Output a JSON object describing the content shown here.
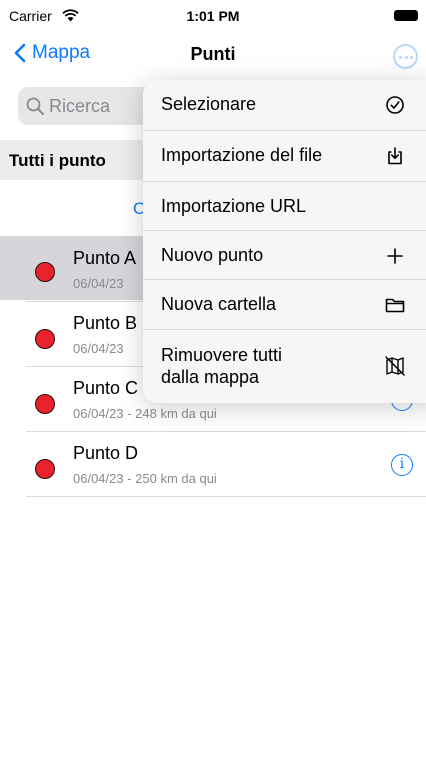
{
  "status": {
    "carrier": "Carrier",
    "time": "1:01 PM"
  },
  "nav": {
    "back_label": "Mappa",
    "title": "Punti"
  },
  "search": {
    "placeholder": "Ricerca"
  },
  "section": {
    "title": "Tutti i punto"
  },
  "sort_label": "O",
  "points": [
    {
      "name": "Punto A",
      "subtitle": "06/04/23",
      "selected": true
    },
    {
      "name": "Punto B",
      "subtitle": "06/04/23"
    },
    {
      "name": "Punto C",
      "subtitle": "06/04/23 - 248 km da qui"
    },
    {
      "name": "Punto D",
      "subtitle": "06/04/23 - 250 km da qui"
    }
  ],
  "menu": [
    {
      "label": "Selezionare",
      "icon": "checkmark-circle-icon"
    },
    {
      "label": "Importazione del file",
      "icon": "import-file-icon"
    },
    {
      "label": "Importazione URL",
      "icon": ""
    },
    {
      "label": "Nuovo punto",
      "icon": "plus-icon"
    },
    {
      "label": "Nuova cartella",
      "icon": "folder-icon"
    },
    {
      "label": "Rimuovere tutti\ndalla mappa",
      "icon": "map-slash-icon"
    }
  ],
  "colors": {
    "accent": "#0a7aff",
    "point": "#e8232e"
  }
}
